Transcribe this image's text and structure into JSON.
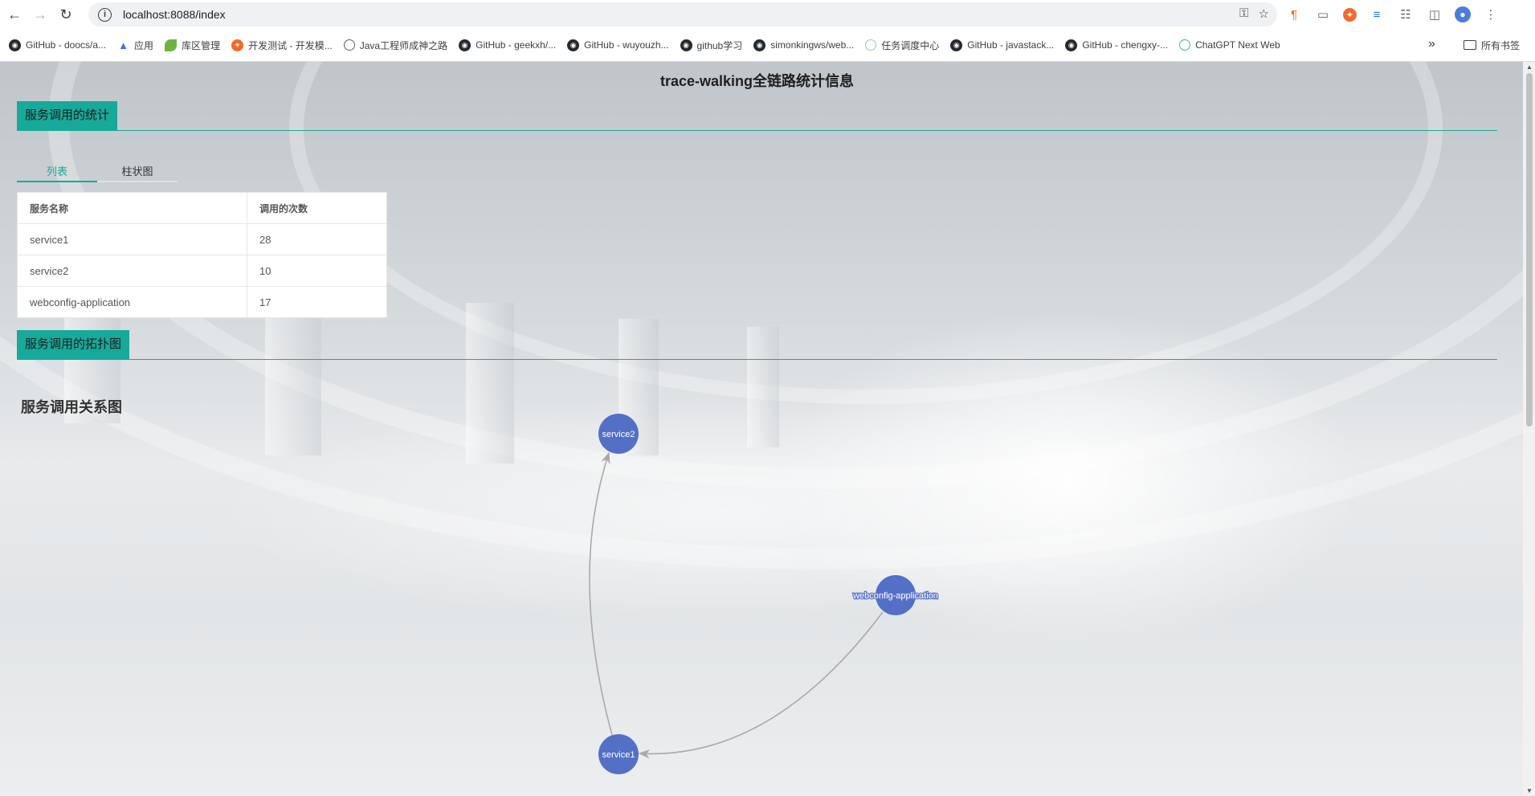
{
  "browser": {
    "url": "localhost:8088/index",
    "bookmarks": [
      {
        "label": "GitHub - doocs/a...",
        "icon": "github-icon"
      },
      {
        "label": "应用",
        "icon": "apps-icon"
      },
      {
        "label": "库区管理",
        "icon": "leaf-icon"
      },
      {
        "label": "开发测试 - 开发模...",
        "icon": "dev-icon"
      },
      {
        "label": "Java工程师成神之路",
        "icon": "globe-icon"
      },
      {
        "label": "GitHub - geekxh/...",
        "icon": "github-icon"
      },
      {
        "label": "GitHub - wuyouzh...",
        "icon": "github-icon"
      },
      {
        "label": "github学习",
        "icon": "github-icon"
      },
      {
        "label": "simonkingws/web...",
        "icon": "github-icon"
      },
      {
        "label": "任务调度中心",
        "icon": "schedule-icon"
      },
      {
        "label": "GitHub - javastack...",
        "icon": "github-icon"
      },
      {
        "label": "GitHub - chengxy-...",
        "icon": "github-icon"
      },
      {
        "label": "ChatGPT Next Web",
        "icon": "chatgpt-icon"
      }
    ],
    "more_bookmarks": "»",
    "all_bookmarks": "所有书签"
  },
  "page": {
    "title": "trace-walking全链路统计信息",
    "stats_section": {
      "heading": "服务调用的统计",
      "tabs": [
        "列表",
        "柱状图"
      ],
      "active_tab": 0,
      "table": {
        "headers": [
          "服务名称",
          "调用的次数"
        ],
        "rows": [
          [
            "service1",
            "28"
          ],
          [
            "service2",
            "10"
          ],
          [
            "webconfig-application",
            "17"
          ]
        ]
      }
    },
    "topology_section": {
      "heading": "服务调用的拓扑图",
      "graph_title": "服务调用关系图",
      "nodes": [
        "service2",
        "webconfig-application",
        "service1"
      ],
      "edges": [
        {
          "from": "webconfig-application",
          "to": "service1"
        },
        {
          "from": "service1",
          "to": "service2"
        }
      ],
      "node_color": "#5470c6",
      "edge_color": "#aaaaaa"
    }
  },
  "colors": {
    "accent": "#17a99a"
  }
}
